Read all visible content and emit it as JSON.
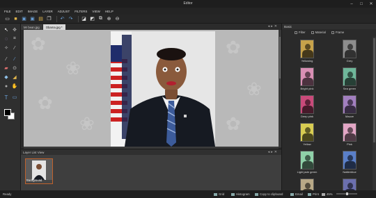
{
  "window": {
    "title": "Editor"
  },
  "menu": [
    "FILE",
    "EDIT",
    "IMAGE",
    "LAYER",
    "ADJUST",
    "FILTERS",
    "VIEW",
    "HELP"
  ],
  "document_tabs": [
    {
      "label": "Mr bean.jpg"
    },
    {
      "label": "Obama.jpg *"
    }
  ],
  "layer_panel": {
    "title": "Layer List View",
    "layer_label": "Background"
  },
  "basic_panel": {
    "title": "Basic",
    "tabs": [
      "Filter",
      "Material",
      "Frame"
    ],
    "presets": [
      {
        "label": "Yellowing",
        "color": "#c7a24a"
      },
      {
        "label": "Grey",
        "color": "#8d8d8d"
      },
      {
        "label": "Bright pink",
        "color": "#d98fb4"
      },
      {
        "label": "Sea green",
        "color": "#6fb79a"
      },
      {
        "label": "Deep pink",
        "color": "#c94a7a"
      },
      {
        "label": "Mauve",
        "color": "#a27fbf"
      },
      {
        "label": "Yellow",
        "color": "#d8cc52"
      },
      {
        "label": "Pink",
        "color": "#e2a6c5"
      },
      {
        "label": "Light jade green",
        "color": "#8fd1a9"
      },
      {
        "label": "Nattierblue",
        "color": "#5a7fc8"
      },
      {
        "label": "",
        "color": "#b9a987"
      },
      {
        "label": "",
        "color": "#6b6fae"
      }
    ]
  },
  "status": {
    "ready": "Ready",
    "grid": "Grid",
    "histogram": "Histogram",
    "copy": "Copy to clipboard",
    "email": "Email",
    "print": "Print",
    "zoom": "45%"
  }
}
